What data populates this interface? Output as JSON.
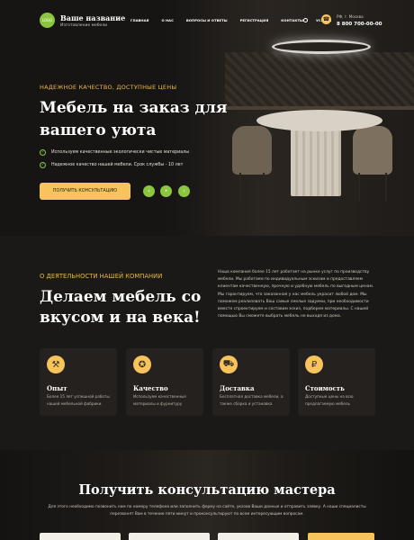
{
  "header": {
    "logo_text": "LOGO",
    "brand_name": "Ваше название",
    "brand_sub": "Изготовление мебели",
    "nav": [
      "ГЛАВНАЯ",
      "О НАС",
      "ВОПРОСЫ И ОТВЕТЫ",
      "РЕГИСТРАЦИЯ",
      "КОНТАКТЫ",
      "УСЛУГИ"
    ],
    "region": "РФ, г. Москва",
    "phone": "8 800 700-00-00"
  },
  "hero": {
    "tagline": "НАДЕЖНОЕ КАЧЕСТВО, ДОСТУПНЫЕ ЦЕНЫ",
    "title": "Мебель на заказ для вашего уюта",
    "features": [
      "Используем качественные экологически чистые материалы",
      "Надежное качество нашей мебели. Срок службы - 10 лет"
    ],
    "cta": "ПОЛУЧИТЬ КОНСУЛЬТАЦИЮ",
    "arrows": [
      "‹",
      "•",
      "›"
    ]
  },
  "about": {
    "tag": "О ДЕЯТЕЛЬНОСТИ НАШЕЙ КОМПАНИИ",
    "title": "Делаем мебель со вкусом и на века!",
    "text": "Наша компания более 15 лет работает на рынке услуг по производству мебели. Мы работаем по индивидуальным эскизам и предоставляем клиентам качественную, прочную и удобную мебель по выгодным ценам. Мы гарантируем, что заказанная у нас мебель украсит любой дом. Мы поможем реализовать Ваш самые смелые задумки, при необходимости вместе спроектируем и составим эскиз, подберем материалы. С нашей помощью Вы сможете выбрать мебель не выходя из дома.",
    "cards": [
      {
        "icon": "experience-icon",
        "glyph": "⚒",
        "title": "Опыт",
        "desc": "Более 15 лет успешной работы нашей мебельной фабрики"
      },
      {
        "icon": "quality-icon",
        "glyph": "✪",
        "title": "Качество",
        "desc": "Используем качественные материалы и фурнитуру"
      },
      {
        "icon": "delivery-icon",
        "glyph": "⛟",
        "title": "Доставка",
        "desc": "Бесплатная доставка мебели, а также сборка и установка"
      },
      {
        "icon": "price-icon",
        "glyph": "₽",
        "title": "Стоимость",
        "desc": "Доступные цены на всю предлагаемую мебель"
      }
    ]
  },
  "consult": {
    "title": "Получить консультацию мастера",
    "text": "Для этого необходимо позвонить нам по номеру телефона или заполнить форму на сайте, указав Ваши данные и отправить заявку. А наши специалисты перезвонят Вам в течение пяти минут и проконсультируют по всем интересующим вопросам."
  },
  "colors": {
    "accent": "#f6c35c",
    "green": "#8cc63f",
    "background": "#1a1816"
  }
}
